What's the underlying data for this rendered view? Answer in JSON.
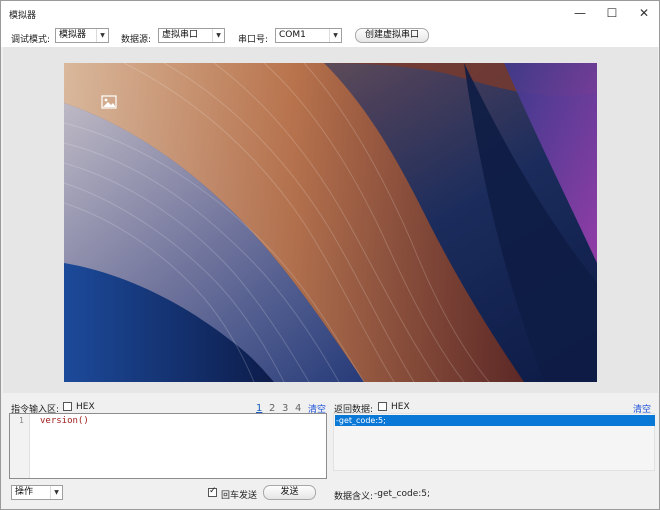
{
  "window": {
    "title": "模拟器",
    "controls": {
      "minimize": "—",
      "maximize": "☐",
      "close": "✕"
    }
  },
  "toolbar": {
    "mode_label": "调试模式:",
    "mode_value": "模拟器",
    "source_label": "数据源:",
    "source_value": "虚拟串口",
    "port_label": "串口号:",
    "port_value": "COM1",
    "create_button": "创建虚拟串口",
    "dropdown_arrow": "▼"
  },
  "preview": {
    "icon": "image-icon"
  },
  "command": {
    "label": "指令输入区:",
    "hex_label": "HEX",
    "hex_checked": false,
    "pages": [
      "1",
      "2",
      "3",
      "4"
    ],
    "active_page": 0,
    "clear_label": "清空",
    "line_number": "1",
    "code": "version()"
  },
  "returned": {
    "label": "返回数据:",
    "hex_label": "HEX",
    "hex_checked": false,
    "clear_label": "清空",
    "rows": [
      "-get_code:5;"
    ]
  },
  "footer": {
    "ops_value": "操作",
    "crlf_label": "回车发送",
    "crlf_checked": true,
    "send_button": "发送",
    "meaning_label": "数据含义:",
    "meaning_value": "-get_code:5;"
  },
  "colors": {
    "accent": "#0a78d7",
    "link": "#1a4fd8",
    "code": "#a02020"
  }
}
